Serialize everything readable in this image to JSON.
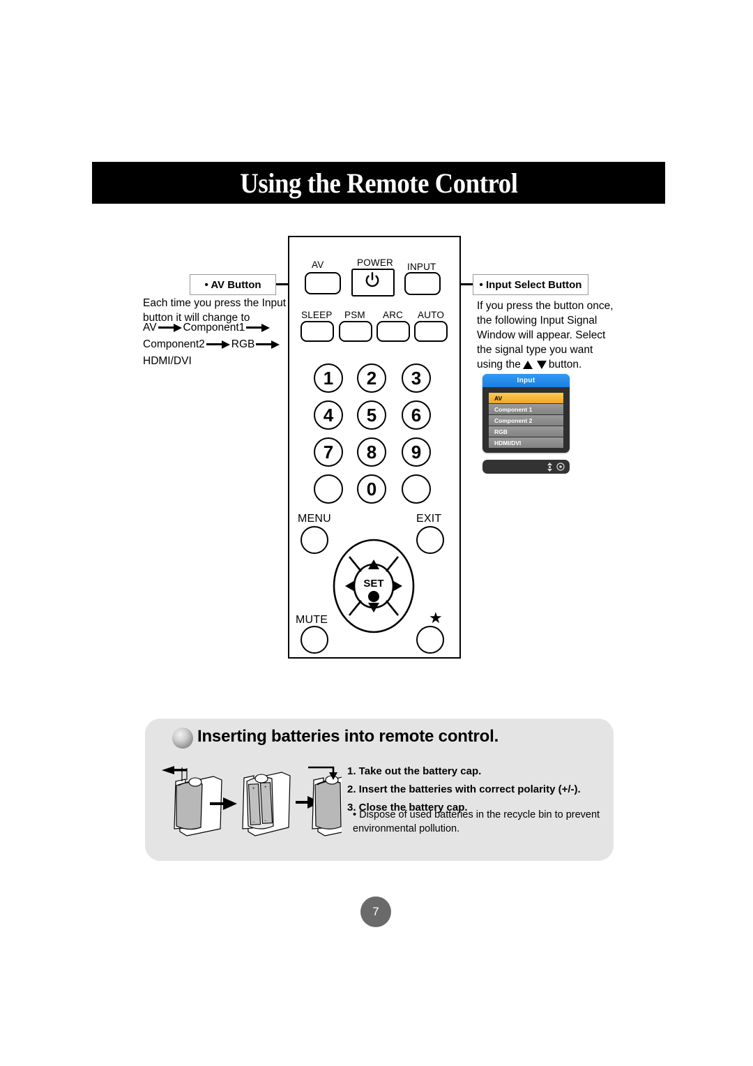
{
  "header": {
    "title": "Using the Remote Control"
  },
  "callouts": {
    "av": {
      "title": "• AV Button",
      "line1": "Each time you press the Input",
      "line2": "button it will change to",
      "flow": [
        "AV",
        "Component1",
        "Component2",
        "RGB",
        "HDMI/DVI"
      ]
    },
    "input_select": {
      "title": "• Input Select Button",
      "line1": "If you press the button once,",
      "line2": "the following Input Signal",
      "line3": "Window will appear. Select",
      "line4": "the signal type you want",
      "line5_prefix": "using the",
      "line5_suffix": "button."
    }
  },
  "osd": {
    "title": "Input",
    "items": [
      {
        "label": "AV",
        "selected": true
      },
      {
        "label": "Component 1",
        "selected": false
      },
      {
        "label": "Component 2",
        "selected": false
      },
      {
        "label": "RGB",
        "selected": false
      },
      {
        "label": "HDMI/DVI",
        "selected": false
      }
    ],
    "title_color": "#2f8ceb",
    "selected_color": "#f5b632",
    "row_color": "#8e8e8e",
    "background_color": "#2f2f2f"
  },
  "remote": {
    "top_row": [
      {
        "label": "AV",
        "shape": "rounded"
      },
      {
        "label": "POWER",
        "shape": "rect",
        "icon": "power-icon"
      },
      {
        "label": "INPUT",
        "shape": "rounded"
      }
    ],
    "second_row": [
      {
        "label": "SLEEP"
      },
      {
        "label": "PSM"
      },
      {
        "label": "ARC"
      },
      {
        "label": "AUTO"
      }
    ],
    "keypad": [
      "1",
      "2",
      "3",
      "4",
      "5",
      "6",
      "7",
      "8",
      "9",
      "",
      "0",
      ""
    ],
    "nav": {
      "menu": "MENU",
      "exit": "EXIT",
      "mute": "MUTE",
      "star": "★",
      "set": "SET",
      "up": "up-arrow",
      "down": "down-arrow",
      "left": "left-arrow",
      "right": "right-arrow"
    }
  },
  "battery": {
    "heading": "Inserting batteries into remote control.",
    "steps": [
      "1. Take out the battery cap.",
      "2. Insert the batteries with correct polarity (+/-).",
      "3. Close the battery cap."
    ],
    "note": "• Dispose of used batteries in the recycle bin to prevent environmental pollution.",
    "panel_color": "#e4e4e4"
  },
  "page_number": "7"
}
